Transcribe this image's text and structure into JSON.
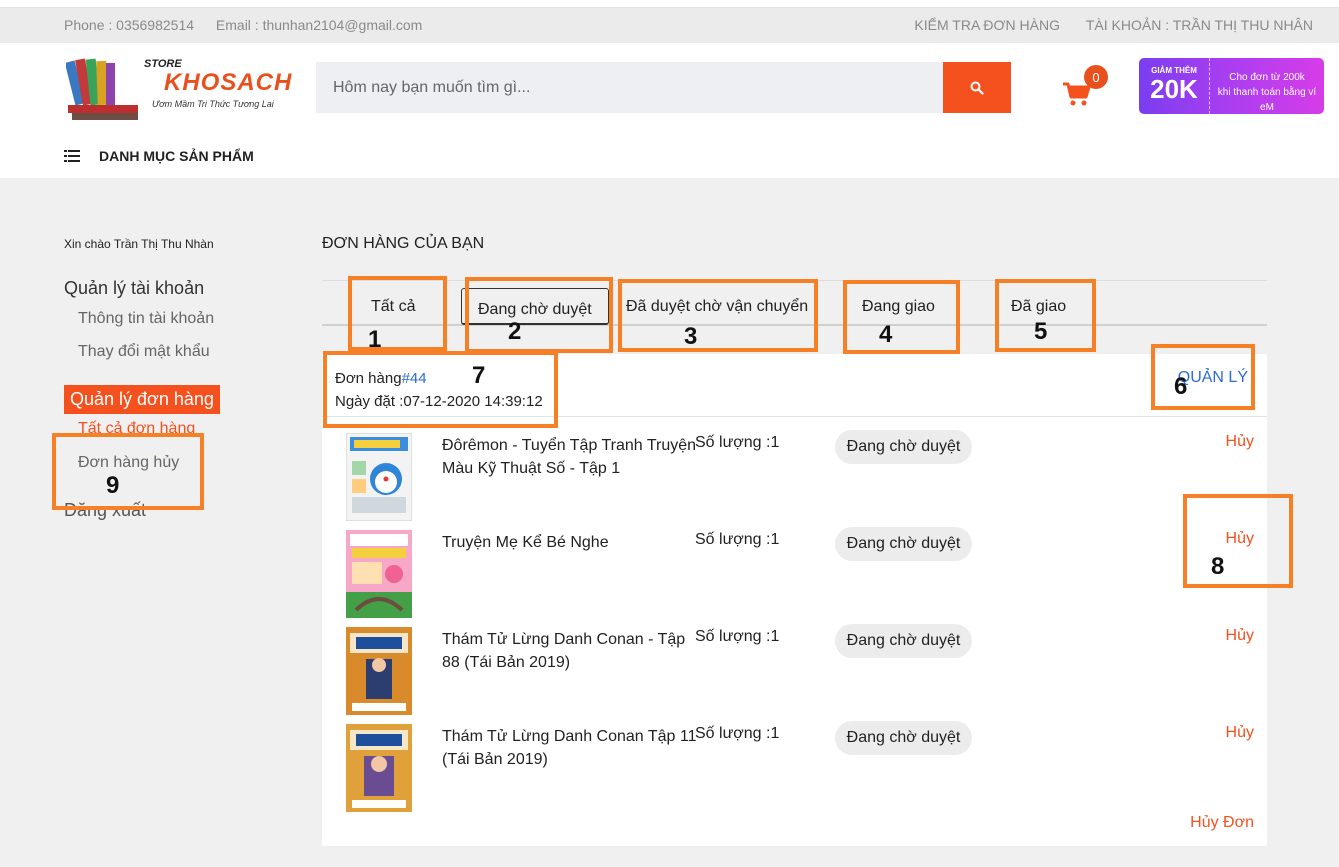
{
  "topbar": {
    "phone": "Phone : 0356982514",
    "email": "Email : thunhan2104@gmail.com",
    "check_order": "KIỂM TRA ĐƠN HÀNG",
    "account": "TÀI KHOẢN : TRẦN THỊ THU NHÂN"
  },
  "logo": {
    "store": "STORE",
    "name": "KHOSACH",
    "slogan": "Ươm Mầm Tri Thức Tương Lai"
  },
  "search": {
    "placeholder": "Hôm nay bạn muốn tìm gì..."
  },
  "cart": {
    "count": "0"
  },
  "promo": {
    "top": "GIẢM THÊM",
    "amount": "20K",
    "line1": "Cho đơn từ 200k",
    "line2": "khi thanh toán bằng ví eM"
  },
  "category_menu": {
    "label": "DANH MỤC SẢN PHẨM"
  },
  "sidebar": {
    "greeting": "Xin chào Trần Thị Thu Nhàn",
    "account_heading": "Quản lý tài khoản",
    "account_info": "Thông tin tài khoản",
    "change_password": "Thay đổi mật khẩu",
    "orders_heading": "Quản lý đơn hàng",
    "all_orders": "Tất cả đơn hàng",
    "cancelled_orders": "Đơn hàng hủy",
    "logout": "Đăng xuất"
  },
  "main": {
    "title": "ĐƠN HÀNG CỦA BẠN",
    "tabs": [
      {
        "label": "Tất cả"
      },
      {
        "label": "Đang chờ duyệt"
      },
      {
        "label": "Đã duyệt chờ vận chuyển"
      },
      {
        "label": "Đang giao"
      },
      {
        "label": "Đã giao"
      }
    ],
    "active_tab": "Đang chờ duyệt"
  },
  "order": {
    "label": "Đơn hàng",
    "id": "#44",
    "date": "Ngày đặt :07-12-2020 14:39:12",
    "manage": "QUẢN LÝ",
    "cancel_order": "Hủy Đơn",
    "items": [
      {
        "title": "Đôrêmon - Tuyển Tập Tranh Truyện Màu Kỹ Thuật Số - Tập 1",
        "qty": "Số lượng :1",
        "status": "Đang chờ duyệt",
        "cancel": "Hủy"
      },
      {
        "title": "Truyện Mẹ Kể Bé Nghe",
        "qty": "Số lượng :1",
        "status": "Đang chờ duyệt",
        "cancel": "Hủy"
      },
      {
        "title": "Thám Tử Lừng Danh Conan - Tập 88 (Tái Bản 2019)",
        "qty": "Số lượng :1",
        "status": "Đang chờ duyệt",
        "cancel": "Hủy"
      },
      {
        "title": "Thám Tử Lừng Danh Conan Tập 11 (Tái Bản 2019)",
        "qty": "Số lượng :1",
        "status": "Đang chờ duyệt",
        "cancel": "Hủy"
      }
    ]
  },
  "annotations": [
    "1",
    "2",
    "3",
    "4",
    "5",
    "6",
    "7",
    "8",
    "9"
  ],
  "colors": {
    "accent": "#f4511e",
    "annotation": "#f58025",
    "link": "#2b6bd6"
  }
}
